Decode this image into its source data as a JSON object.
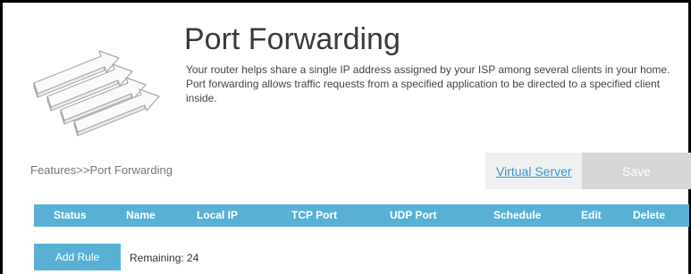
{
  "page": {
    "title": "Port Forwarding",
    "description": "Your router helps share a single IP address assigned by your ISP among several clients in your home. Port forwarding allows traffic requests from a specified application to be directed to a specified client inside."
  },
  "breadcrumb": "Features>>Port Forwarding",
  "actions": {
    "virtual_server_label": "Virtual Server",
    "save_label": "Save"
  },
  "table": {
    "columns": [
      "Status",
      "Name",
      "Local IP",
      "TCP Port",
      "UDP Port",
      "Schedule",
      "Edit",
      "Delete"
    ]
  },
  "footer": {
    "add_rule_label": "Add Rule",
    "remaining_text": "Remaining: 24"
  },
  "colors": {
    "accent": "#58b1d4",
    "link": "#3d95c3",
    "save_disabled": "#d4d6d8"
  },
  "icons": {
    "hero": "port-forwarding-arrows-icon"
  }
}
